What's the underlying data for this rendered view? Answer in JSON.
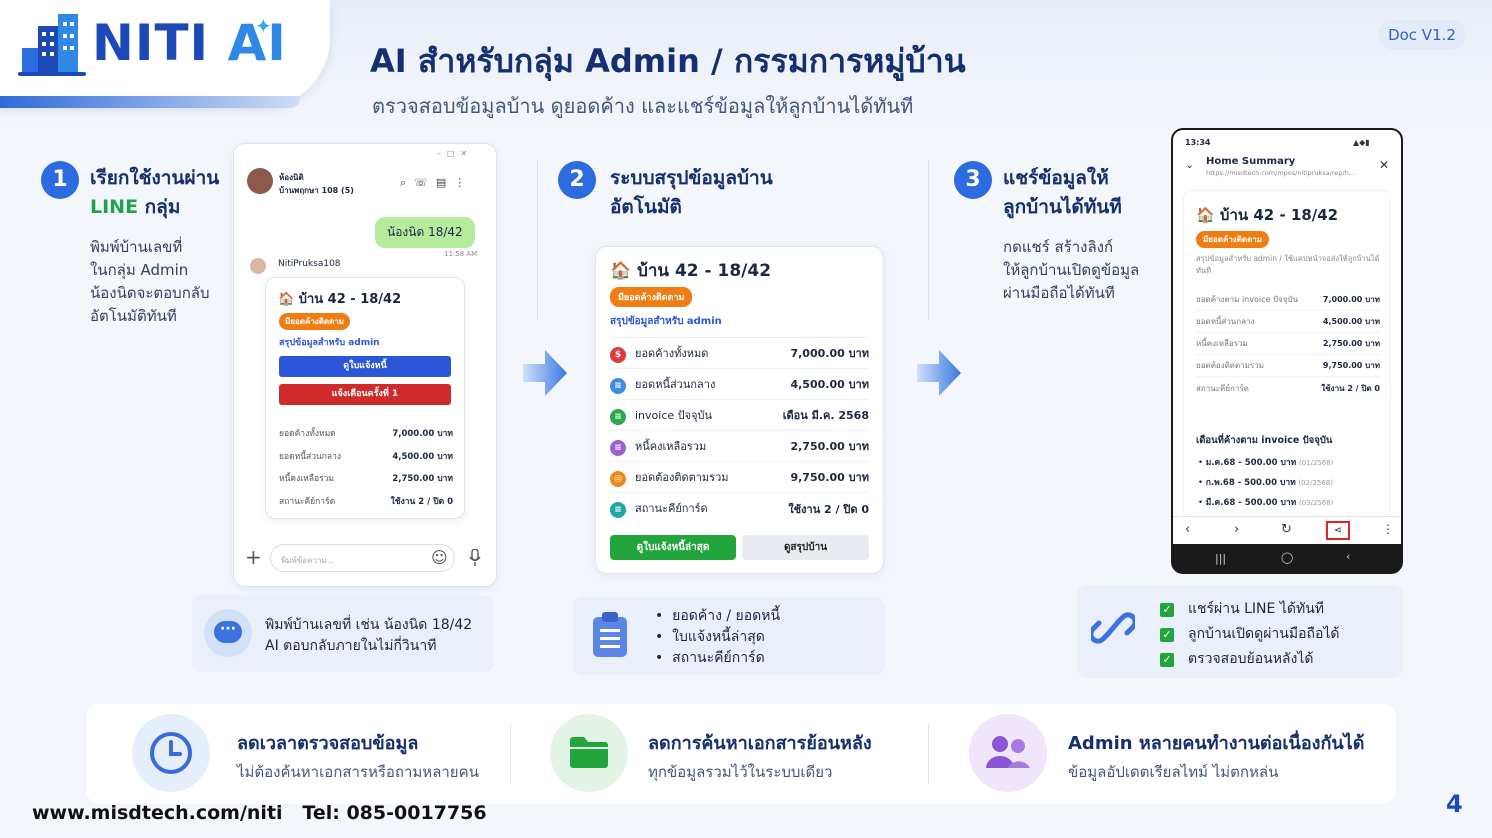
{
  "brand": {
    "name_a": "NITI",
    "name_b": "AI",
    "doc_version": "Doc V1.2"
  },
  "header": {
    "title": "AI  สำหรับกลุ่ม Admin / กรรมการหมู่บ้าน",
    "subtitle": "ตรวจสอบข้อมูลบ้าน ดูยอดค้าง และแชร์ข้อมูลให้ลูกบ้านได้ทันที"
  },
  "steps": [
    {
      "num": "1",
      "title_a": "เรียกใช้งานผ่าน",
      "title_line": "LINE",
      "title_b": " กลุ่ม",
      "desc": [
        "พิมพ์บ้านเลขที่",
        "ในกลุ่ม Admin",
        "น้องนิดจะตอบกลับ",
        "อัตโนมัติทันที"
      ]
    },
    {
      "num": "2",
      "title_a": "ระบบสรุปข้อมูลบ้าน",
      "title_b": "อัตโนมัติ"
    },
    {
      "num": "3",
      "title_a": "แชร์ข้อมูลให้",
      "title_b": "ลูกบ้านได้ทันที",
      "desc": [
        "กดแชร์ สร้างลิงก์",
        "ให้ลูกบ้านเปิดดูข้อมูล",
        "ผ่านมือถือได้ทันที"
      ]
    }
  ],
  "chat": {
    "room_name": "ห้องนิติ",
    "room_sub": "บ้านพฤกษา 108 (5)",
    "user_message": "น้องนิด 18/42",
    "time": "11:58 AM",
    "bot_name": "NitiPruksa108",
    "card_title": "บ้าน 42 - 18/42",
    "badge": "มียอดค้างติดตาม",
    "for_admin": "สรุปข้อมูลสำหรับ admin",
    "btn_view": "ดูใบแจ้งหนี้",
    "btn_notify": "แจ้งเตือนครั้งที่ 1",
    "rows": [
      {
        "label": "ยอดค้างทั้งหมด",
        "value": "7,000.00 บาท"
      },
      {
        "label": "ยอดหนี้ส่วนกลาง",
        "value": "4,500.00 บาท"
      },
      {
        "label": "หนี้คงเหลือรวม",
        "value": "2,750.00 บาท"
      },
      {
        "label": "สถานะคีย์การ์ด",
        "value": "ใช้งาน 2 / ปิด 0"
      }
    ],
    "input_placeholder": "พิมพ์ข้อความ..."
  },
  "info1": {
    "line1": "พิมพ์บ้านเลขที่ เช่น น้องนิด 18/42",
    "line2": "AI ตอบกลับภายในไม่กี่วินาที"
  },
  "summary": {
    "title": "บ้าน 42 - 18/42",
    "badge": "มียอดค้างติดตาม",
    "for_admin": "สรุปข้อมูลสำหรับ admin",
    "rows": [
      {
        "icon": "$",
        "color": "#e23b3b",
        "label": "ยอดค้างทั้งหมด",
        "value": "7,000.00 บาท"
      },
      {
        "icon": "≡",
        "color": "#3b8ee8",
        "label": "ยอดหนี้ส่วนกลาง",
        "value": "4,500.00 บาท"
      },
      {
        "icon": "≡",
        "color": "#2aa84a",
        "label": "invoice ปัจจุบัน",
        "value": "เดือน มี.ค. 2568"
      },
      {
        "icon": "≡",
        "color": "#9b5fd6",
        "label": "หนี้คงเหลือรวม",
        "value": "2,750.00 บาท"
      },
      {
        "icon": "◎",
        "color": "#ef8a1a",
        "label": "ยอดต้องติดตามรวม",
        "value": "9,750.00 บาท"
      },
      {
        "icon": "≡",
        "color": "#20a7a0",
        "label": "สถานะคีย์การ์ด",
        "value": "ใช้งาน 2 / ปิด 0"
      }
    ],
    "btn_latest": "ดูใบแจ้งหนี้ล่าสุด",
    "btn_home": "ดูสรุปบ้าน"
  },
  "info2": {
    "items": [
      "ยอดค้าง / ยอดหนี้",
      "ใบแจ้งหนี้ล่าสุด",
      "สถานะคีย์การ์ด"
    ]
  },
  "phone": {
    "status_time": "13:34",
    "page_title": "Home Summary",
    "url": "https://misdtech.com/mpos/nitipruksa/rep/h...",
    "card_title": "บ้าน 42 - 18/42",
    "badge": "มียอดค้างติดตาม",
    "note": "สรุปข้อมูลสำหรับ admin / ใช้แคปหน้าจอส่งให้ลูกบ้านได้ทันที",
    "rows": [
      {
        "label": "ยอดค้างตาม invoice ปัจจุบัน",
        "value": "7,000.00 บาท"
      },
      {
        "label": "ยอดหนี้ส่วนกลาง",
        "value": "4,500.00 บาท"
      },
      {
        "label": "หนี้คงเหลือรวม",
        "value": "2,750.00 บาท"
      },
      {
        "label": "ยอดต้องติดตามรวม",
        "value": "9,750.00 บาท"
      },
      {
        "label": "สถานะคีย์การ์ด",
        "value": "ใช้งาน 2 / ปิด 0"
      }
    ],
    "months_title": "เดือนที่ค้างตาม invoice ปัจจุบัน",
    "months": [
      {
        "label": "ม.ค.68 - 500.00 บาท",
        "code": "(01/2568)"
      },
      {
        "label": "ก.พ.68 - 500.00 บาท",
        "code": "(02/2568)"
      },
      {
        "label": "มี.ค.68 - 500.00 บาท",
        "code": "(03/2568)"
      }
    ]
  },
  "info3": {
    "items": [
      "แชร์ผ่าน LINE ได้ทันที",
      "ลูกบ้านเปิดดูผ่านมือถือได้",
      "ตรวจสอบย้อนหลังได้"
    ]
  },
  "benefits": [
    {
      "title": "ลดเวลาตรวจสอบข้อมูล",
      "desc": "ไม่ต้องค้นหาเอกสารหรือถามหลายคน"
    },
    {
      "title": "ลดการค้นหาเอกสารย้อนหลัง",
      "desc": "ทุกข้อมูลรวมไว้ในระบบเดียว"
    },
    {
      "title": "Admin หลายคนทำงานต่อเนื่องกันได้",
      "desc": "ข้อมูลอัปเดตเรียลไทม์ ไม่ตกหล่น"
    }
  ],
  "footer": {
    "website": "www.misdtech.com/niti",
    "tel": "Tel: 085-0017756",
    "page": "4"
  }
}
